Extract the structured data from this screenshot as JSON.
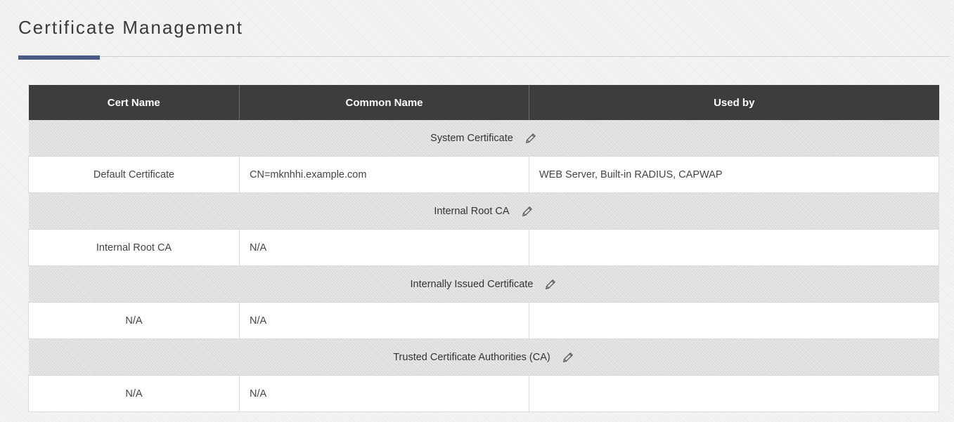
{
  "page": {
    "title": "Certificate Management"
  },
  "colors": {
    "header_bg": "#3d3d3d",
    "accent": "#4a5a85",
    "section_bg": "#e2e2e2"
  },
  "table": {
    "headers": [
      "Cert Name",
      "Common Name",
      "Used by"
    ],
    "sections": [
      {
        "label": "System Certificate",
        "icon": "pencil-edit-icon",
        "rows": [
          {
            "cert_name": "Default Certificate",
            "common_name": "CN=mknhhi.example.com",
            "used_by": "WEB Server, Built-in RADIUS, CAPWAP"
          }
        ]
      },
      {
        "label": "Internal Root CA",
        "icon": "pencil-edit-icon",
        "rows": [
          {
            "cert_name": "Internal Root CA",
            "common_name": "N/A",
            "used_by": ""
          }
        ]
      },
      {
        "label": "Internally Issued Certificate",
        "icon": "pencil-edit-icon",
        "rows": [
          {
            "cert_name": "N/A",
            "common_name": "N/A",
            "used_by": ""
          }
        ]
      },
      {
        "label": "Trusted Certificate Authorities (CA)",
        "icon": "pencil-edit-icon",
        "rows": [
          {
            "cert_name": "N/A",
            "common_name": "N/A",
            "used_by": ""
          }
        ]
      }
    ]
  }
}
